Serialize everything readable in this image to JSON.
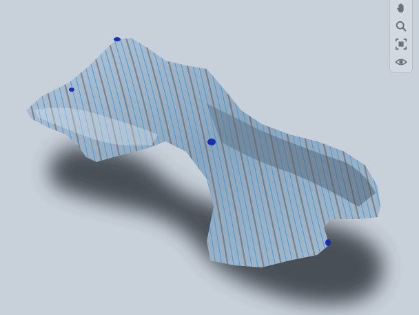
{
  "viewer": {
    "background_color": "#c8d0da",
    "model_color_base": "#9fb4c8",
    "model_slice_color": "#3fa0e6",
    "shadow_color": "#3e454d"
  },
  "toolbar": {
    "tools": [
      {
        "icon": "hand-pan-icon",
        "tooltip": ""
      },
      {
        "icon": "zoom-icon",
        "tooltip": ""
      },
      {
        "icon": "fit-view-icon",
        "tooltip": ""
      },
      {
        "icon": "eye-visibility-icon",
        "tooltip": ""
      }
    ]
  }
}
